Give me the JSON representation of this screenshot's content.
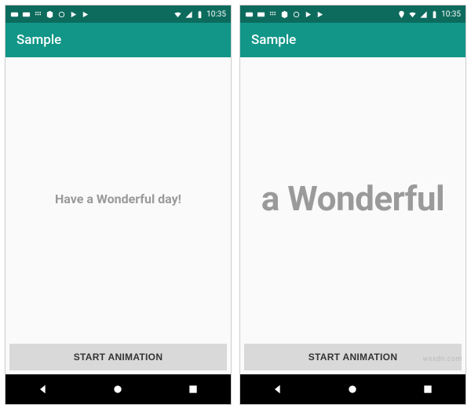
{
  "statusbar": {
    "time": "10:35",
    "icons_left": [
      "youtube",
      "video",
      "apps",
      "maps",
      "circle",
      "play",
      "play"
    ],
    "icons_right_phone1": [
      "wifi",
      "signal",
      "battery"
    ],
    "icons_right_phone2": [
      "location",
      "wifi",
      "signal",
      "battery"
    ]
  },
  "appbar": {
    "title": "Sample"
  },
  "phone1": {
    "message": "Have a Wonderful day!"
  },
  "phone2": {
    "message": "a Wonderful"
  },
  "button": {
    "label": "START ANIMATION"
  },
  "watermark": "wsxdn.com"
}
